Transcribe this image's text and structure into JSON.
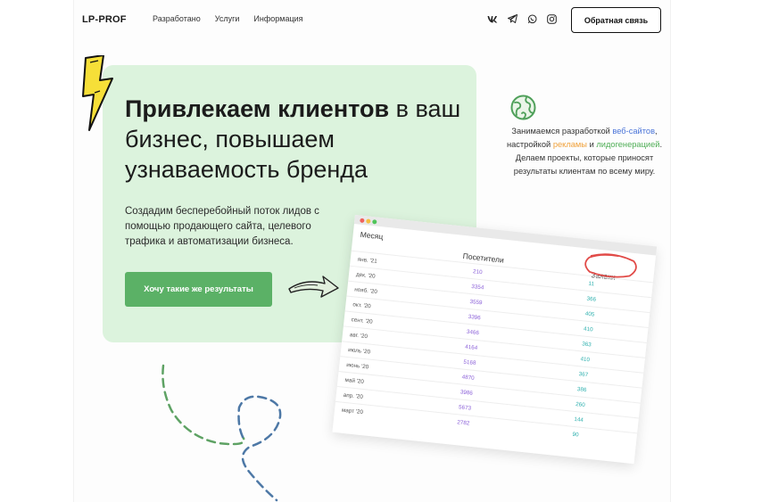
{
  "header": {
    "logo": "LP-PROF",
    "nav": [
      "Разработано",
      "Услуги",
      "Информация"
    ],
    "social_icons": [
      "vk-icon",
      "telegram-icon",
      "whatsapp-icon",
      "instagram-icon"
    ],
    "feedback_label": "Обратная связь"
  },
  "hero": {
    "headline_bold": "Привлекаем клиентов",
    "headline_rest": " в ваш бизнес, повышаем узнаваемость бренда",
    "subtitle": "Создадим бесперебойный поток лидов с помощью продающего сайта, целевого трафика и автоматизации бизнеса.",
    "cta_label": "Хочу такие же результаты"
  },
  "about": {
    "icon": "globe-icon",
    "t1": "Занимаемся разработкой ",
    "w1": "веб-сайтов",
    "t2": ", настройкой ",
    "w2": "рекламы",
    "t3": " и ",
    "w3": "лидогенерацией",
    "t4": ". Делаем проекты, которые приносят результаты клиентам по всему миру."
  },
  "table": {
    "col_month": "Месяц",
    "col_visitors": "Посетители",
    "col_leads": "Заявки",
    "rows": [
      {
        "month": "янв. '21",
        "visitors": "210",
        "leads": "11"
      },
      {
        "month": "дек. '20",
        "visitors": "3354",
        "leads": "366"
      },
      {
        "month": "нояб. '20",
        "visitors": "3559",
        "leads": "405"
      },
      {
        "month": "окт. '20",
        "visitors": "3396",
        "leads": "410"
      },
      {
        "month": "сент. '20",
        "visitors": "3466",
        "leads": "363"
      },
      {
        "month": "авг. '20",
        "visitors": "4164",
        "leads": "410"
      },
      {
        "month": "июль '20",
        "visitors": "5168",
        "leads": "367"
      },
      {
        "month": "июнь '20",
        "visitors": "4870",
        "leads": "386"
      },
      {
        "month": "май '20",
        "visitors": "3986",
        "leads": "260"
      },
      {
        "month": "апр. '20",
        "visitors": "5673",
        "leads": "144"
      },
      {
        "month": "март '20",
        "visitors": "2782",
        "leads": "90"
      }
    ]
  },
  "colors": {
    "hero_bg": "#dcf3dd",
    "cta": "#5bb166",
    "blue": "#4a74d8",
    "orange": "#f0a13a",
    "green": "#4fae56"
  }
}
